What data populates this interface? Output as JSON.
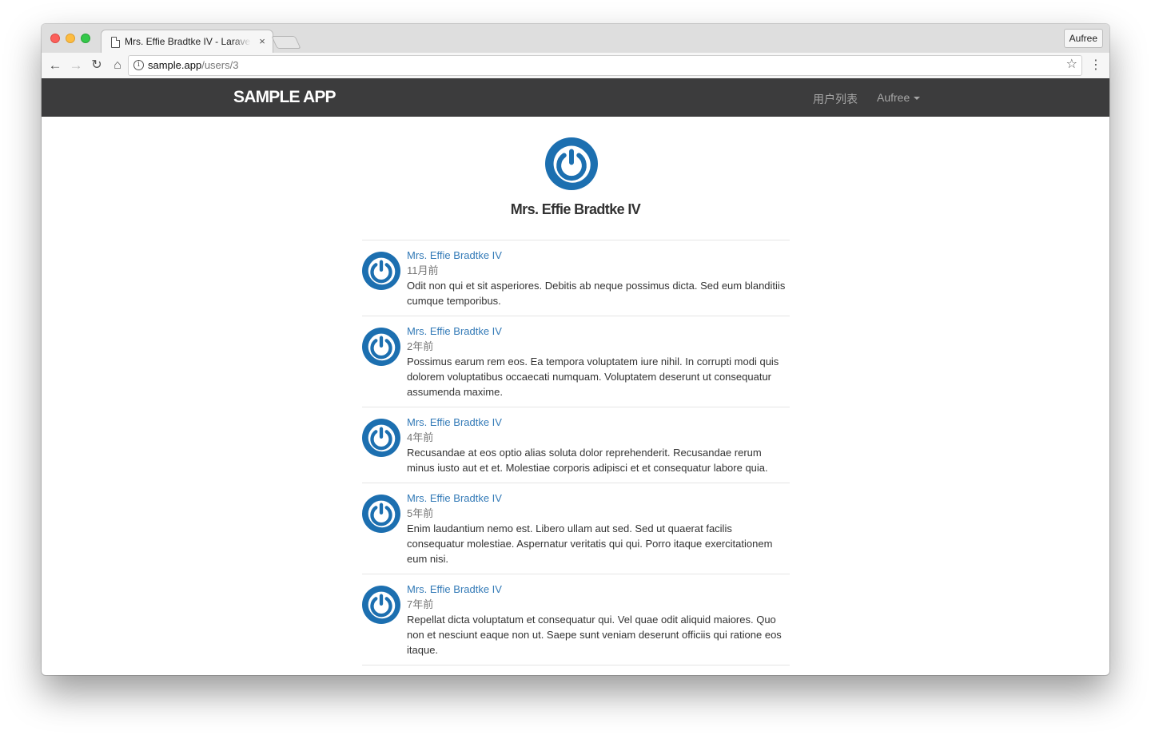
{
  "browser": {
    "tab_title": "Mrs. Effie Bradtke IV - Laravel",
    "tab_close": "×",
    "profile_name": "Aufree",
    "url_host": "sample.app",
    "url_path": "/users/3",
    "icons": [
      "back-arrow-icon",
      "forward-arrow-icon",
      "reload-icon",
      "home-icon",
      "info-icon",
      "star-icon",
      "kebab-menu-icon"
    ]
  },
  "navbar": {
    "brand": "SAMPLE APP",
    "users_link": "用户列表",
    "account_menu": "Aufree"
  },
  "colors": {
    "navbar_bg": "#3c3c3d",
    "link": "#337ab7",
    "gravatar_blue": "#1c6fb0"
  },
  "profile": {
    "name": "Mrs. Effie Bradtke IV"
  },
  "statuses": [
    {
      "author": "Mrs. Effie Bradtke IV",
      "time": "11月前",
      "text": "Odit non qui et sit asperiores. Debitis ab neque possimus dicta. Sed eum blanditiis cumque temporibus."
    },
    {
      "author": "Mrs. Effie Bradtke IV",
      "time": "2年前",
      "text": "Possimus earum rem eos. Ea tempora voluptatem iure nihil. In corrupti modi quis dolorem voluptatibus occaecati numquam. Voluptatem deserunt ut consequatur assumenda maxime."
    },
    {
      "author": "Mrs. Effie Bradtke IV",
      "time": "4年前",
      "text": "Recusandae at eos optio alias soluta dolor reprehenderit. Recusandae rerum minus iusto aut et et. Molestiae corporis adipisci et et consequatur labore quia."
    },
    {
      "author": "Mrs. Effie Bradtke IV",
      "time": "5年前",
      "text": "Enim laudantium nemo est. Libero ullam aut sed. Sed ut quaerat facilis consequatur molestiae. Aspernatur veritatis qui qui. Porro itaque exercitationem eum nisi."
    },
    {
      "author": "Mrs. Effie Bradtke IV",
      "time": "7年前",
      "text": "Repellat dicta voluptatum et consequatur qui. Vel quae odit aliquid maiores. Quo non et nesciunt eaque non ut. Saepe sunt veniam deserunt officiis qui ratione eos itaque."
    },
    {
      "author": "Mrs. Effie Bradtke IV",
      "time": "",
      "text": ""
    }
  ]
}
